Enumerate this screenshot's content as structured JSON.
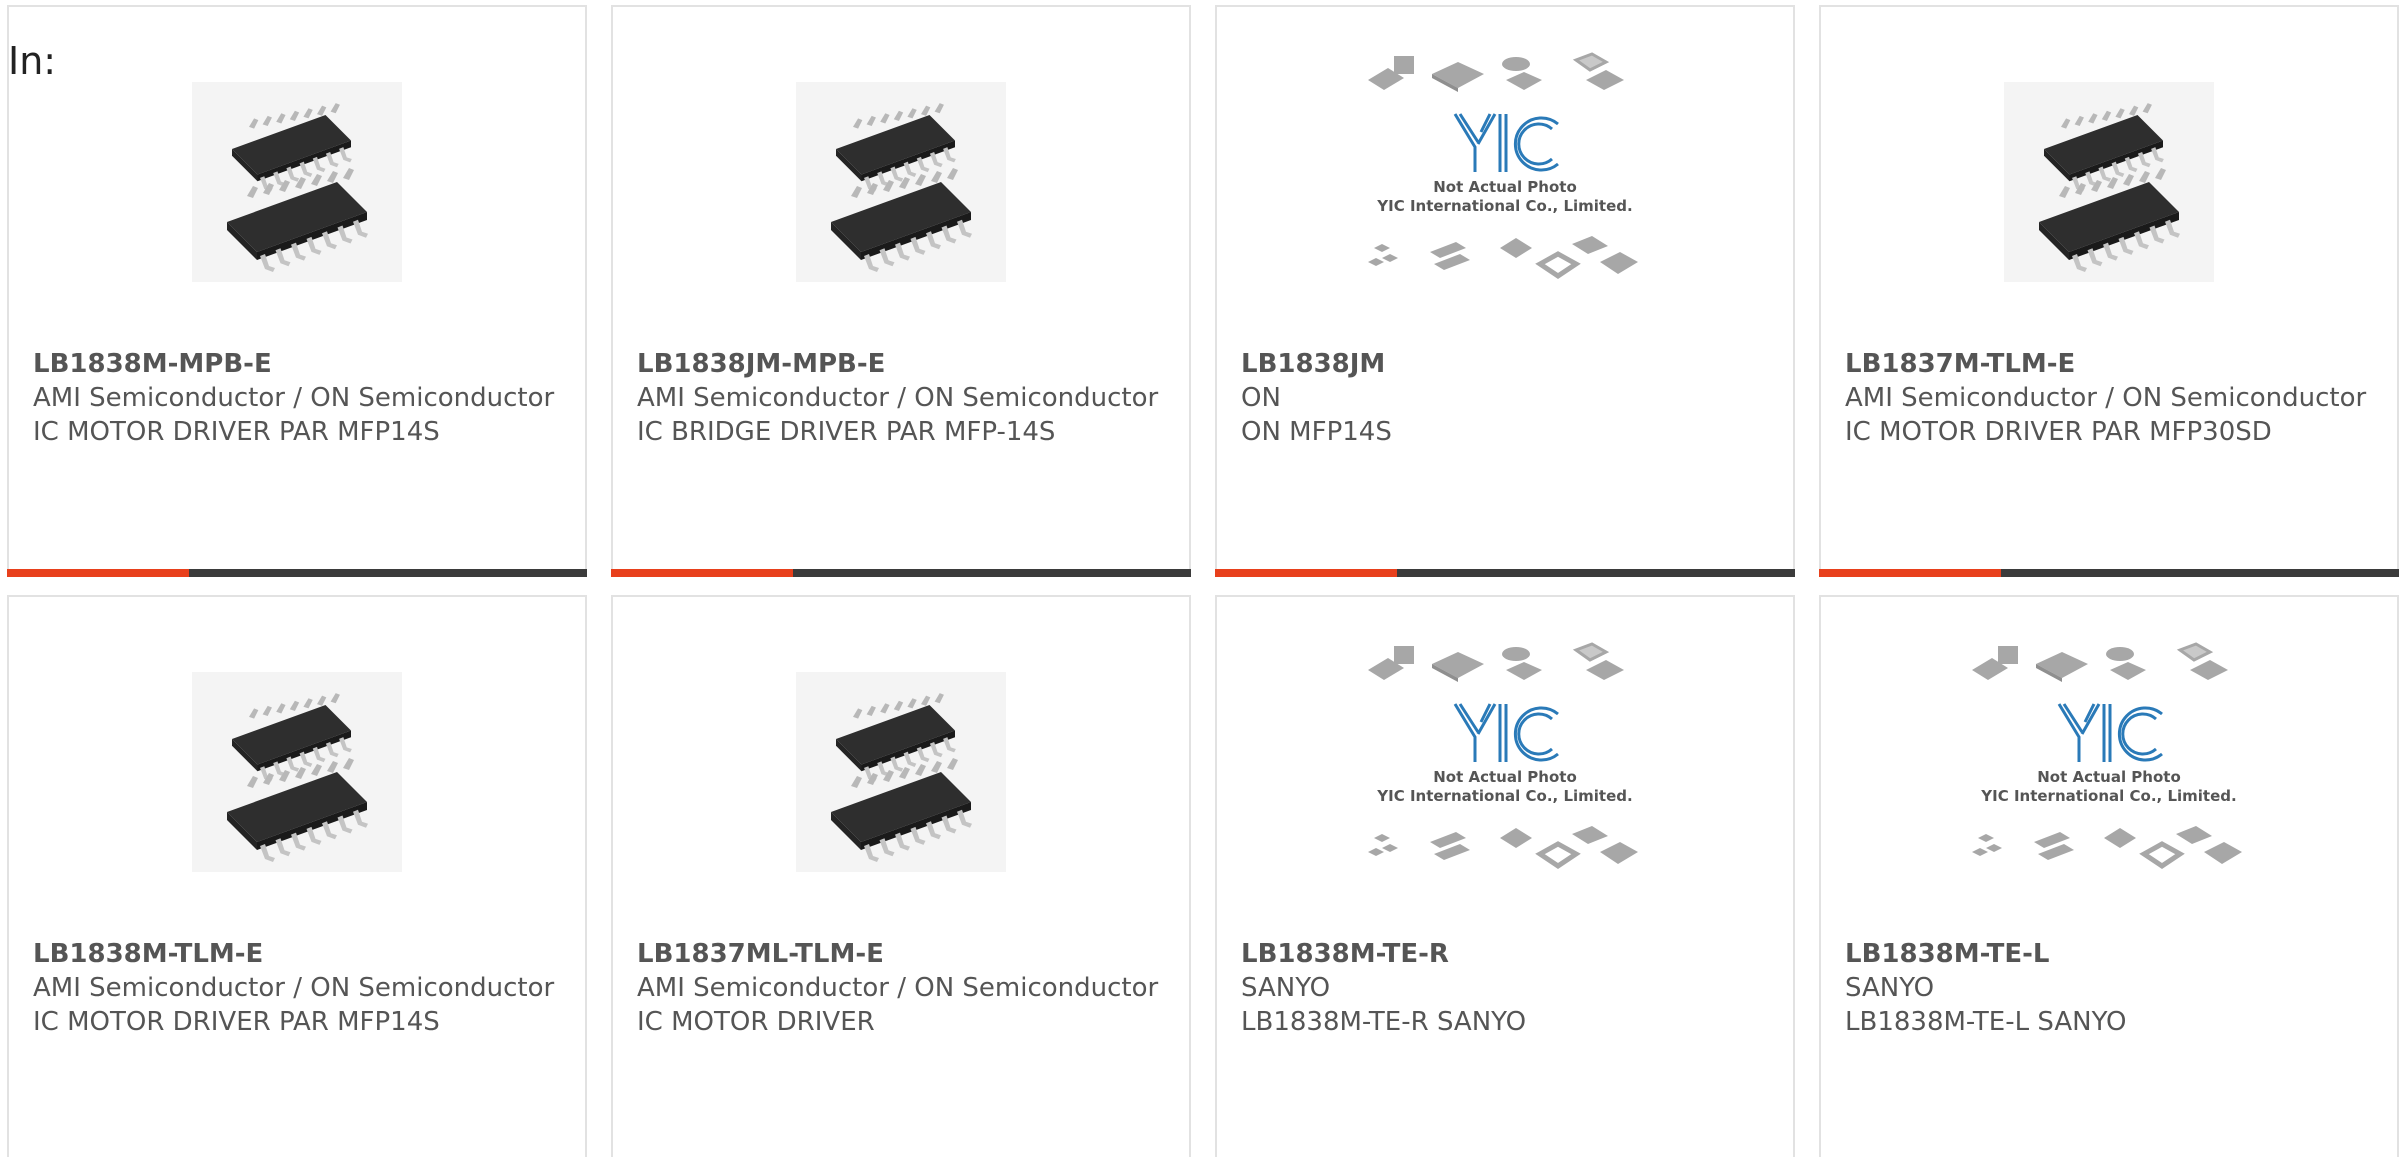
{
  "header": {
    "label": "In:"
  },
  "colors": {
    "accent": "#e8401c",
    "bar": "#3b3b3b",
    "text": "#555555",
    "border": "#e2e2e2",
    "yic_blue": "#2a7ab8"
  },
  "products": [
    {
      "part_number": "LB1838M-MPB-E",
      "manufacturer": "AMI Semiconductor / ON Semiconductor",
      "description": "IC MOTOR DRIVER PAR MFP14S",
      "image": "soic-chip-photo"
    },
    {
      "part_number": "LB1838JM-MPB-E",
      "manufacturer": "AMI Semiconductor / ON Semiconductor",
      "description": "IC BRIDGE DRIVER PAR MFP-14S",
      "image": "soic-chip-photo"
    },
    {
      "part_number": "LB1838JM",
      "manufacturer": "ON",
      "description": "ON MFP14S",
      "image": "yic-placeholder",
      "placeholder_line1": "Not Actual Photo",
      "placeholder_line2": "YIC International Co., Limited."
    },
    {
      "part_number": "LB1837M-TLM-E",
      "manufacturer": "AMI Semiconductor / ON Semiconductor",
      "description": "IC MOTOR DRIVER PAR MFP30SD",
      "image": "soic-chip-photo"
    },
    {
      "part_number": "LB1838M-TLM-E",
      "manufacturer": "AMI Semiconductor / ON Semiconductor",
      "description": "IC MOTOR DRIVER PAR MFP14S",
      "image": "soic-chip-photo"
    },
    {
      "part_number": "LB1837ML-TLM-E",
      "manufacturer": "AMI Semiconductor / ON Semiconductor",
      "description": "IC MOTOR DRIVER",
      "image": "soic-chip-photo"
    },
    {
      "part_number": "LB1838M-TE-R",
      "manufacturer": "SANYO",
      "description": "LB1838M-TE-R SANYO",
      "image": "yic-placeholder",
      "placeholder_line1": "Not Actual Photo",
      "placeholder_line2": "YIC International Co., Limited."
    },
    {
      "part_number": "LB1838M-TE-L",
      "manufacturer": "SANYO",
      "description": "LB1838M-TE-L SANYO",
      "image": "yic-placeholder",
      "placeholder_line1": "Not Actual Photo",
      "placeholder_line2": "YIC International Co., Limited."
    }
  ]
}
